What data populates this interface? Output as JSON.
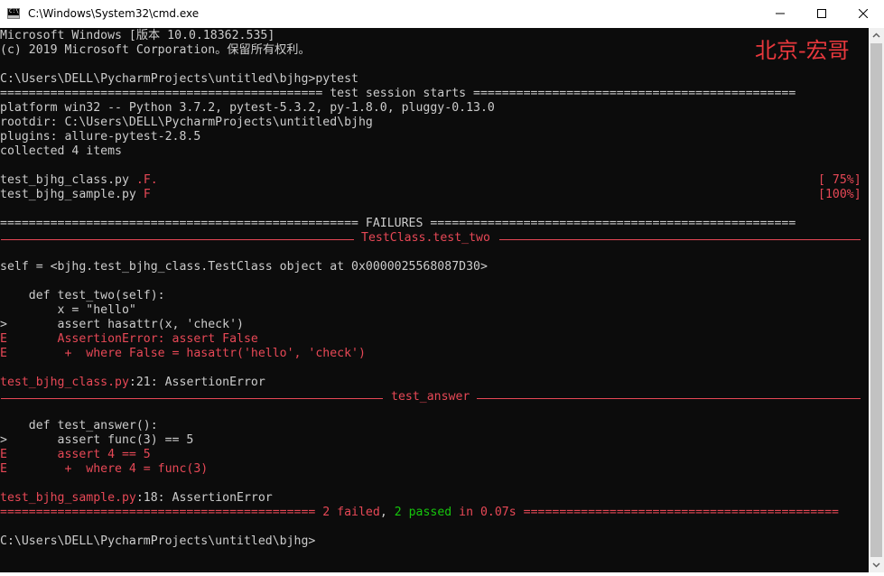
{
  "window": {
    "title": "C:\\Windows\\System32\\cmd.exe",
    "icon": "cmd-icon",
    "icon_text": "C:\\",
    "controls": [
      "minimize-icon",
      "maximize-icon",
      "close-icon"
    ]
  },
  "watermark": "北京-宏哥",
  "colors": {
    "background": "#0c0c0c",
    "text": "#cccccc",
    "red": "#e74856",
    "green": "#16c60c",
    "watermark": "#e8383d"
  },
  "terminal": {
    "banner": [
      "Microsoft Windows [版本 10.0.18362.535]",
      "(c) 2019 Microsoft Corporation。保留所有权利。"
    ],
    "prompt1": "C:\\Users\\DELL\\PycharmProjects\\untitled\\bjhg>",
    "command": "pytest",
    "session_header": "============================================= test session starts =============================================",
    "platform": "platform win32 -- Python 3.7.2, pytest-5.3.2, py-1.8.0, pluggy-0.13.0",
    "rootdir": "rootdir: C:\\Users\\DELL\\PycharmProjects\\untitled\\bjhg",
    "plugins": "plugins: allure-pytest-2.8.5",
    "collected": "collected 4 items",
    "results": [
      {
        "file": "test_bjhg_class.py",
        "marks": ".F.",
        "progress": "[ 75%]"
      },
      {
        "file": "test_bjhg_sample.py",
        "marks": "F",
        "progress": "[100%]"
      }
    ],
    "failures_header": "================================================== FAILURES ===================================================",
    "failure1": {
      "title": "TestClass.test_two",
      "self_line": "self = <bjhg.test_bjhg_class.TestClass object at 0x0000025568087D30>",
      "code": [
        "    def test_two(self):",
        "        x = \"hello\"",
        ">       assert hasattr(x, 'check')"
      ],
      "errors": [
        "E       AssertionError: assert False",
        "E        +  where False = hasattr('hello', 'check')"
      ],
      "location_file": "test_bjhg_class.py",
      "location_rest": ":21: AssertionError"
    },
    "failure2": {
      "title": "test_answer",
      "code": [
        "    def test_answer():",
        ">       assert func(3) == 5"
      ],
      "errors": [
        "E       assert 4 == 5",
        "E        +  where 4 = func(3)"
      ],
      "location_file": "test_bjhg_sample.py",
      "location_rest": ":18: AssertionError"
    },
    "summary": {
      "left": "============================================ ",
      "failed": "2 failed",
      "comma": ", ",
      "passed": "2 passed",
      "right": " in 0.07s ============================================"
    },
    "prompt2": "C:\\Users\\DELL\\PycharmProjects\\untitled\\bjhg>"
  }
}
